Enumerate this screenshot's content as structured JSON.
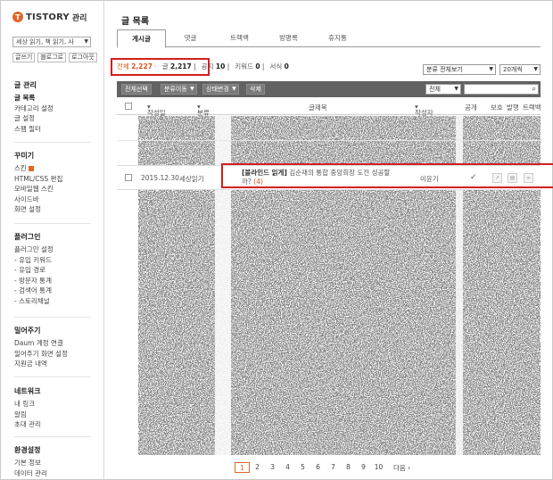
{
  "sidebar": {
    "logo_text": "TISTORY",
    "logo_sub": "관리",
    "blog_select": "세상 읽기, 책 읽기, 사",
    "top_links": [
      "글쓰기",
      "블로그로",
      "로그아웃"
    ],
    "sections": [
      {
        "title": "글 관리",
        "items": [
          "글 목록",
          "카테고리 설정",
          "글 설정",
          "스팸 필터"
        ]
      },
      {
        "title": "꾸미기",
        "items": [
          "스킨",
          "HTML/CSS 편집",
          "모바일웹 스킨",
          "사이드바",
          "화면 설정"
        ]
      },
      {
        "title": "플러그인",
        "items": [
          "플러그인 설정",
          "- 유입 키워드",
          "- 유입 경로",
          "- 방문자 통계",
          "- 검색어 통계",
          "- 스토리채널"
        ]
      },
      {
        "title": "밀어주기",
        "items": [
          "Daum 계정 연결",
          "밀어주기 화면 설정",
          "지원금 내역"
        ]
      },
      {
        "title": "네트워크",
        "items": [
          "내 링크",
          "알림",
          "초대 관리"
        ]
      },
      {
        "title": "환경설정",
        "items": [
          "기본 정보",
          "데이터 관리"
        ]
      }
    ]
  },
  "main": {
    "title": "글 목록",
    "tabs": [
      "게시글",
      "댓글",
      "트랙백",
      "방명록",
      "휴지통"
    ],
    "counts": {
      "all_label": "전체",
      "all_value": "2,227",
      "post_label": "글",
      "post_value": "2,217",
      "notice_label": "공지",
      "notice_value": "10",
      "keyword_label": "키워드",
      "keyword_value": "0",
      "form_label": "서식",
      "form_value": "0"
    },
    "filter_category": "분류 전체보기",
    "filter_per_page": "20개씩",
    "toolbar": {
      "select_all": "전체선택",
      "move_category": "분류이동",
      "change_state": "상태변경",
      "delete": "삭제",
      "search_scope": "전체"
    },
    "columns": {
      "date": "작성일",
      "category": "분류",
      "title": "글제목",
      "author": "작성자",
      "public": "공개",
      "protect": "보호",
      "publish": "발행",
      "trackback": "트랙백"
    },
    "post": {
      "date": "2015.12.30",
      "category": "세상읽기",
      "title_bold": "[블라인드 읽게]",
      "title_rest": " 김순재의 통합 중앙회장 도전 성공할",
      "title_line2": "까? ",
      "comment_count": "(4)",
      "author": "이윤기",
      "public_mark": "✓"
    },
    "pagination": [
      "1",
      "2",
      "3",
      "4",
      "5",
      "6",
      "7",
      "8",
      "9",
      "10"
    ],
    "pagination_next": "다음 ›"
  },
  "colors": {
    "accent": "#e0652a",
    "highlight_box": "#d21f1f",
    "toolbar": "#626262"
  }
}
